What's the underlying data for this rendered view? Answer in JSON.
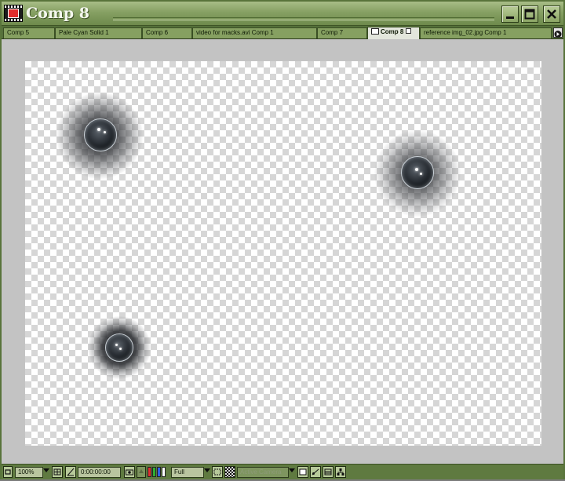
{
  "window": {
    "title": "Comp 8",
    "controls": [
      "minimize-icon",
      "maximize-icon",
      "close-icon"
    ]
  },
  "tabs": [
    {
      "label": "Comp 5",
      "active": false
    },
    {
      "label": "Pale Cyan Solid 1",
      "active": false
    },
    {
      "label": "Comp 6",
      "active": false
    },
    {
      "label": "video for macks.avi Comp 1",
      "active": false
    },
    {
      "label": "Comp 7",
      "active": false
    },
    {
      "label": "Comp 8",
      "active": true
    },
    {
      "label": "reference img_02.jpg Comp 1",
      "active": false
    }
  ],
  "viewer": {
    "transparency_grid": true,
    "bubbles": 3
  },
  "toolbar": {
    "zoom": "100%",
    "timecode": "0:00:00:00",
    "resolution": "Full",
    "camera": "Active Camera",
    "channel_colors": [
      "#e03030",
      "#30b030",
      "#3060e0",
      "#ffffff"
    ]
  },
  "colors": {
    "frame_green": "#86a063",
    "tab_active": "#e3e6dc",
    "viewer_bg": "#c3c3c3"
  }
}
